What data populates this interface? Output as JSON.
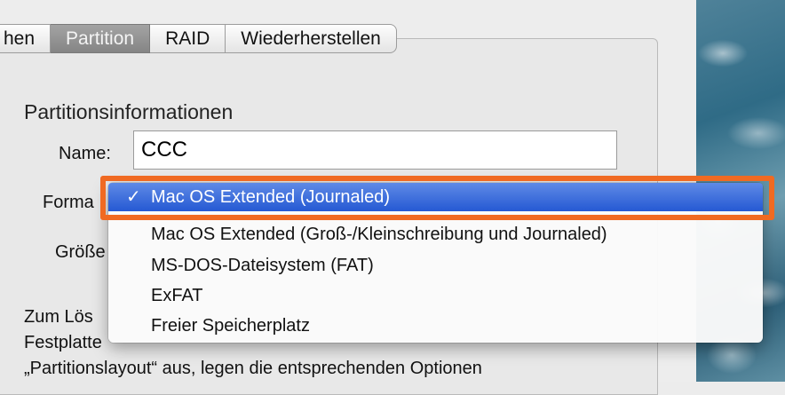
{
  "tabs": [
    {
      "label": "hen",
      "selected": false
    },
    {
      "label": "Partition",
      "selected": true
    },
    {
      "label": "RAID",
      "selected": false
    },
    {
      "label": "Wiederherstellen",
      "selected": false
    }
  ],
  "section_title": "Partitionsinformationen",
  "name": {
    "label": "Name:",
    "value": "CCC"
  },
  "format": {
    "label": "Forma"
  },
  "size": {
    "label": "Größe"
  },
  "format_menu": {
    "selected_index": 0,
    "check_glyph": "✓",
    "items": [
      "Mac OS Extended (Journaled)",
      "Mac OS Extended (Groß-/Kleinschreibung und Journaled)",
      "MS-DOS-Dateisystem (FAT)",
      "ExFAT",
      "Freier Speicherplatz"
    ]
  },
  "description": [
    "Zum Lös",
    "Festplatte",
    "„Partitionslayout“ aus, legen die entsprechenden Optionen"
  ],
  "colors": {
    "highlight_border": "#f06a22",
    "menu_selection": "#2f62d6",
    "selected_tab": "#8c8c8c"
  }
}
